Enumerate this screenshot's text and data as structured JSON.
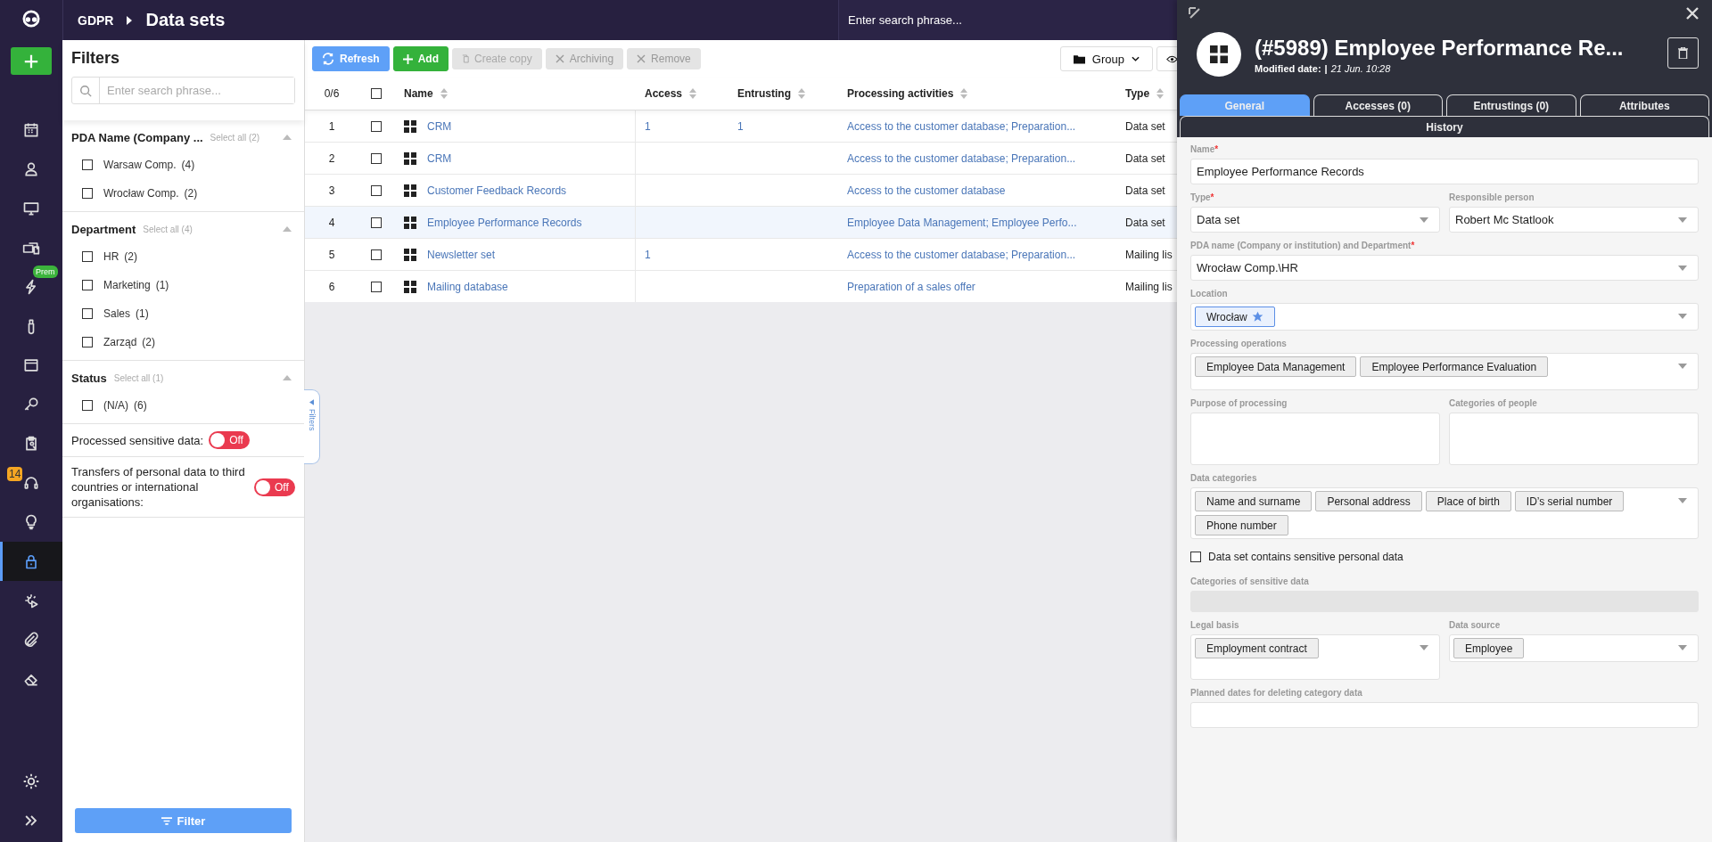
{
  "nav": {
    "items": [
      {
        "selected": false
      },
      {
        "selected": false
      },
      {
        "selected": false
      },
      {
        "selected": false
      },
      {
        "selected": false,
        "badge": {
          "text": "Prem",
          "color": "#3cb43c"
        }
      },
      {
        "selected": false
      },
      {
        "selected": false
      },
      {
        "selected": false
      },
      {
        "selected": false
      },
      {
        "selected": false,
        "badge": {
          "text": "14",
          "color": "#f5a623"
        }
      },
      {
        "selected": false
      },
      {
        "selected": true
      },
      {
        "selected": false
      },
      {
        "selected": false
      },
      {
        "selected": false
      }
    ],
    "bottom_items": [
      {
        "selected": false
      },
      {
        "selected": false
      }
    ]
  },
  "top_bar": {
    "breadcrumb": "GDPR",
    "title": "Data sets",
    "search": {
      "placeholder": "Enter search phrase..."
    }
  },
  "filters": {
    "title": "Filters",
    "search": {
      "placeholder": "Enter search phrase..."
    },
    "groups": [
      {
        "title": "PDA Name (Company ...",
        "select_all": "Select all (2)",
        "expanded": true,
        "options": [
          {
            "label": "Warsaw Comp.",
            "count": "(4)",
            "checked": false
          },
          {
            "label": "Wrocław Comp.",
            "count": "(2)",
            "checked": false
          }
        ]
      },
      {
        "title": "Department",
        "select_all": "Select all (4)",
        "expanded": true,
        "options": [
          {
            "label": "HR",
            "count": "(2)",
            "checked": false
          },
          {
            "label": "Marketing",
            "count": "(1)",
            "checked": false
          },
          {
            "label": "Sales",
            "count": "(1)",
            "checked": false
          },
          {
            "label": "Zarząd",
            "count": "(2)",
            "checked": false
          }
        ]
      },
      {
        "title": "Status",
        "select_all": "Select all (1)",
        "expanded": true,
        "options": [
          {
            "label": "(N/A)",
            "count": "(6)",
            "checked": false
          }
        ]
      }
    ],
    "toggles": [
      {
        "label": "Processed sensitive data:",
        "on": false,
        "state_text": "Off"
      },
      {
        "label": "Transfers of personal data to third countries or international organisations:",
        "on": false,
        "state_text": "Off"
      }
    ],
    "button": "Filter",
    "handle": "Filters"
  },
  "toolbar": {
    "buttons": [
      {
        "label": "Refresh",
        "kind": "refresh",
        "disabled": false
      },
      {
        "label": "Add",
        "kind": "add",
        "disabled": false
      },
      {
        "label": "Create copy",
        "kind": "copy",
        "disabled": true
      },
      {
        "label": "Archiving",
        "kind": "cross",
        "disabled": true
      },
      {
        "label": "Remove",
        "kind": "cross",
        "disabled": true
      }
    ],
    "group": "Group"
  },
  "table": {
    "selection_count": "0/6",
    "all_checked": false,
    "columns": [
      "Name",
      "Access",
      "Entrusting",
      "Processing activities",
      "Type"
    ],
    "rows": [
      {
        "index": "1",
        "checked": false,
        "selected": false,
        "name": "CRM",
        "access": "1",
        "entrusting": "1",
        "processing": "Access to the customer database; Preparation...",
        "type": "Data set"
      },
      {
        "index": "2",
        "checked": false,
        "selected": false,
        "name": "CRM",
        "access": "",
        "entrusting": "",
        "processing": "Access to the customer database; Preparation...",
        "type": "Data set"
      },
      {
        "index": "3",
        "checked": false,
        "selected": false,
        "name": "Customer Feedback Records",
        "access": "",
        "entrusting": "",
        "processing": "Access to the customer database",
        "type": "Data set"
      },
      {
        "index": "4",
        "checked": false,
        "selected": true,
        "name": "Employee Performance Records",
        "access": "",
        "entrusting": "",
        "processing": "Employee Data Management; Employee Perfo...",
        "type": "Data set"
      },
      {
        "index": "5",
        "checked": false,
        "selected": false,
        "name": "Newsletter set",
        "access": "1",
        "entrusting": "",
        "processing": "Access to the customer database; Preparation...",
        "type": "Mailing lis"
      },
      {
        "index": "6",
        "checked": false,
        "selected": false,
        "name": "Mailing database",
        "access": "",
        "entrusting": "",
        "processing": "Preparation of a sales offer",
        "type": "Mailing lis"
      }
    ]
  },
  "drawer": {
    "title": "(#5989) Employee Performance Re...",
    "modified_label": "Modified date:",
    "separator": "|",
    "modified_value": "21 Jun. 10:28",
    "required_mark": "*",
    "tabs": [
      {
        "label": "General",
        "selected": true
      },
      {
        "label": "Accesses (0)",
        "selected": false
      },
      {
        "label": "Entrustings (0)",
        "selected": false
      },
      {
        "label": "Attributes",
        "selected": false
      },
      {
        "label": "History",
        "selected": false
      }
    ],
    "form": [
      [
        {
          "kind": "text",
          "label": "Name",
          "required": true,
          "value": "Employee Performance Records"
        }
      ],
      [
        {
          "kind": "select",
          "label": "Type",
          "required": true,
          "value": "Data set"
        },
        {
          "kind": "select",
          "label": "Responsible person",
          "required": false,
          "value": "Robert Mc Statlook"
        }
      ],
      [
        {
          "kind": "select",
          "label": "PDA name (Company or institution) and Department",
          "required": true,
          "value": "Wrocław Comp.\\HR"
        }
      ],
      [
        {
          "kind": "tags",
          "label": "Location",
          "required": false,
          "tags": [
            {
              "label": "Wrocław",
              "starred": true
            }
          ]
        }
      ],
      [
        {
          "kind": "tags",
          "label": "Processing operations",
          "required": false,
          "tags": [
            {
              "label": "Employee Data Management",
              "starred": false
            },
            {
              "label": "Employee Performance Evaluation",
              "starred": false
            }
          ]
        }
      ],
      [
        {
          "kind": "textarea",
          "label": "Purpose of processing",
          "required": false
        },
        {
          "kind": "textarea",
          "label": "Categories of people",
          "required": false
        }
      ],
      [
        {
          "kind": "tags",
          "label": "Data categories",
          "required": false,
          "tags": [
            {
              "label": "Name and surname",
              "starred": false
            },
            {
              "label": "Personal address",
              "starred": false
            },
            {
              "label": "Place of birth",
              "starred": false
            },
            {
              "label": "ID’s serial number",
              "starred": false
            },
            {
              "label": "Phone number",
              "starred": false
            }
          ]
        }
      ],
      [
        {
          "kind": "checkbox",
          "label": "Data set contains sensitive personal data",
          "checked": false
        }
      ],
      [
        {
          "kind": "disabled",
          "label": "Categories of sensitive data",
          "required": false
        }
      ],
      [
        {
          "kind": "tags",
          "label": "Legal basis",
          "required": false,
          "tags": [
            {
              "label": "Employment contract",
              "starred": false
            }
          ]
        },
        {
          "kind": "tags",
          "label": "Data source",
          "required": false,
          "tags": [
            {
              "label": "Employee",
              "starred": false
            }
          ]
        }
      ],
      [
        {
          "kind": "text",
          "label": "Planned dates for deleting category data",
          "required": false
        }
      ]
    ]
  }
}
